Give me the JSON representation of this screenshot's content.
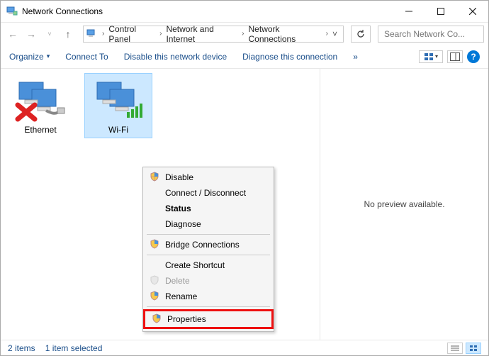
{
  "window": {
    "title": "Network Connections"
  },
  "breadcrumbs": {
    "seg1": "Control Panel",
    "seg2": "Network and Internet",
    "seg3": "Network Connections"
  },
  "search": {
    "placeholder": "Search Network Co..."
  },
  "commands": {
    "organize": "Organize",
    "connect": "Connect To",
    "disable": "Disable this network device",
    "diagnose": "Diagnose this connection"
  },
  "adapters": {
    "ethernet": "Ethernet",
    "wifi": "Wi-Fi"
  },
  "preview": {
    "text": "No preview available."
  },
  "context_menu": {
    "disable": "Disable",
    "connect": "Connect / Disconnect",
    "status": "Status",
    "diagnose": "Diagnose",
    "bridge": "Bridge Connections",
    "shortcut": "Create Shortcut",
    "delete": "Delete",
    "rename": "Rename",
    "properties": "Properties"
  },
  "status": {
    "items": "2 items",
    "selected": "1 item selected"
  }
}
